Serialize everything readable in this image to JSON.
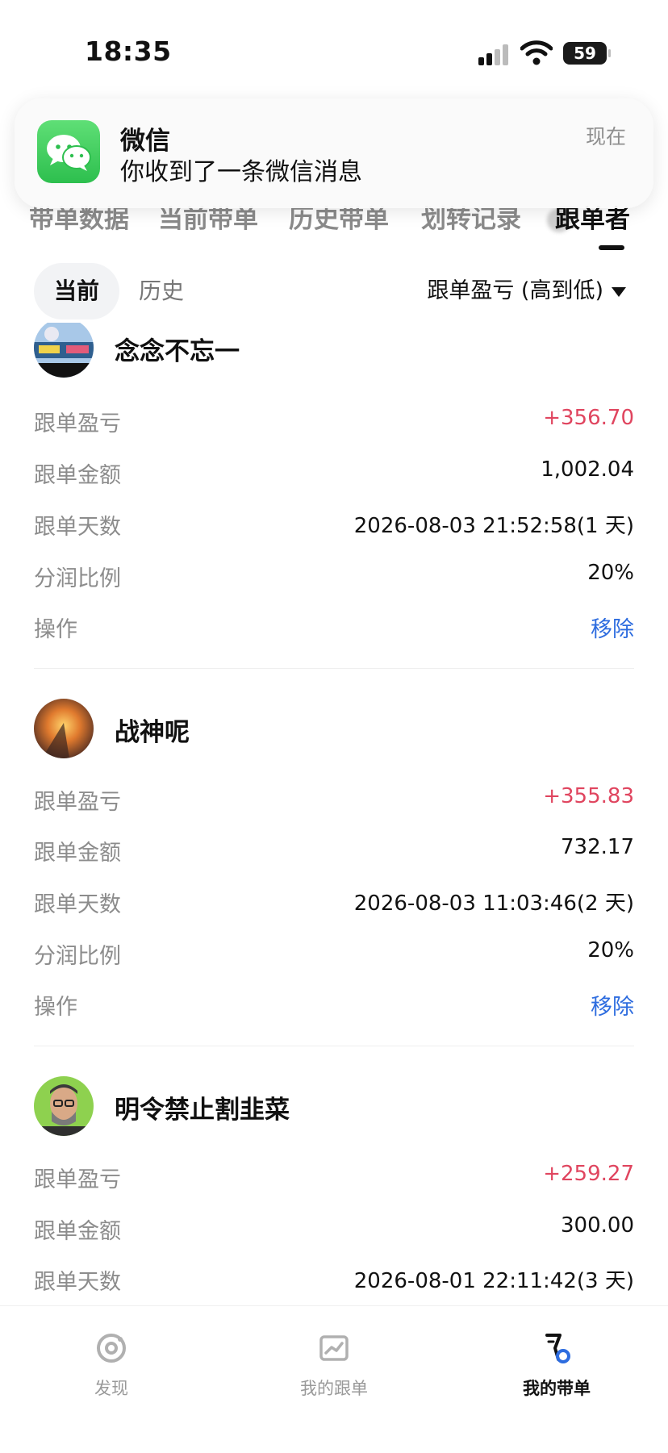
{
  "status_bar": {
    "time": "18:35",
    "battery": "59"
  },
  "header": {
    "tabs": [
      {
        "label": "带单数据"
      },
      {
        "label": "当前带单"
      },
      {
        "label": "历史带单"
      },
      {
        "label": "划转记录"
      },
      {
        "label": "跟单者"
      }
    ],
    "active_tab": "跟单者"
  },
  "notification": {
    "app": "微信",
    "message": "你收到了一条微信消息",
    "time": "现在"
  },
  "filters": {
    "segments": [
      "当前",
      "历史"
    ],
    "active_segment": "当前",
    "sort_label": "跟单盈亏 (高到低)"
  },
  "followers": [
    {
      "name": "念念不忘一",
      "rows": [
        {
          "label": "跟单盈亏",
          "value": "+356.70"
        },
        {
          "label": "跟单金额",
          "value": "1,002.04"
        },
        {
          "label": "跟单天数",
          "value": "2026-08-03 21:52:58(1 天)"
        },
        {
          "label": "分润比例",
          "value": "20%"
        },
        {
          "label": "操作",
          "value": "移除"
        }
      ]
    },
    {
      "name": "战神呢",
      "rows": [
        {
          "label": "跟单盈亏",
          "value": "+355.83"
        },
        {
          "label": "跟单金额",
          "value": "732.17"
        },
        {
          "label": "跟单天数",
          "value": "2026-08-03 11:03:46(2 天)"
        },
        {
          "label": "分润比例",
          "value": "20%"
        },
        {
          "label": "操作",
          "value": "移除"
        }
      ]
    },
    {
      "name": "明令禁止割韭菜",
      "rows": [
        {
          "label": "跟单盈亏",
          "value": "+259.27"
        },
        {
          "label": "跟单金额",
          "value": "300.00"
        },
        {
          "label": "跟单天数",
          "value": "2026-08-01 22:11:42(3 天)"
        }
      ]
    }
  ],
  "bottom_nav": [
    {
      "label": "发现",
      "icon": "discover-icon"
    },
    {
      "label": "我的跟单",
      "icon": "chart-icon"
    },
    {
      "label": "我的带单",
      "icon": "lead-trade-icon"
    }
  ],
  "bottom_nav_active": "我的带单",
  "colors": {
    "profit": "#e0455f",
    "action": "#2d6cdf",
    "wechat": "#2dbf4e"
  }
}
